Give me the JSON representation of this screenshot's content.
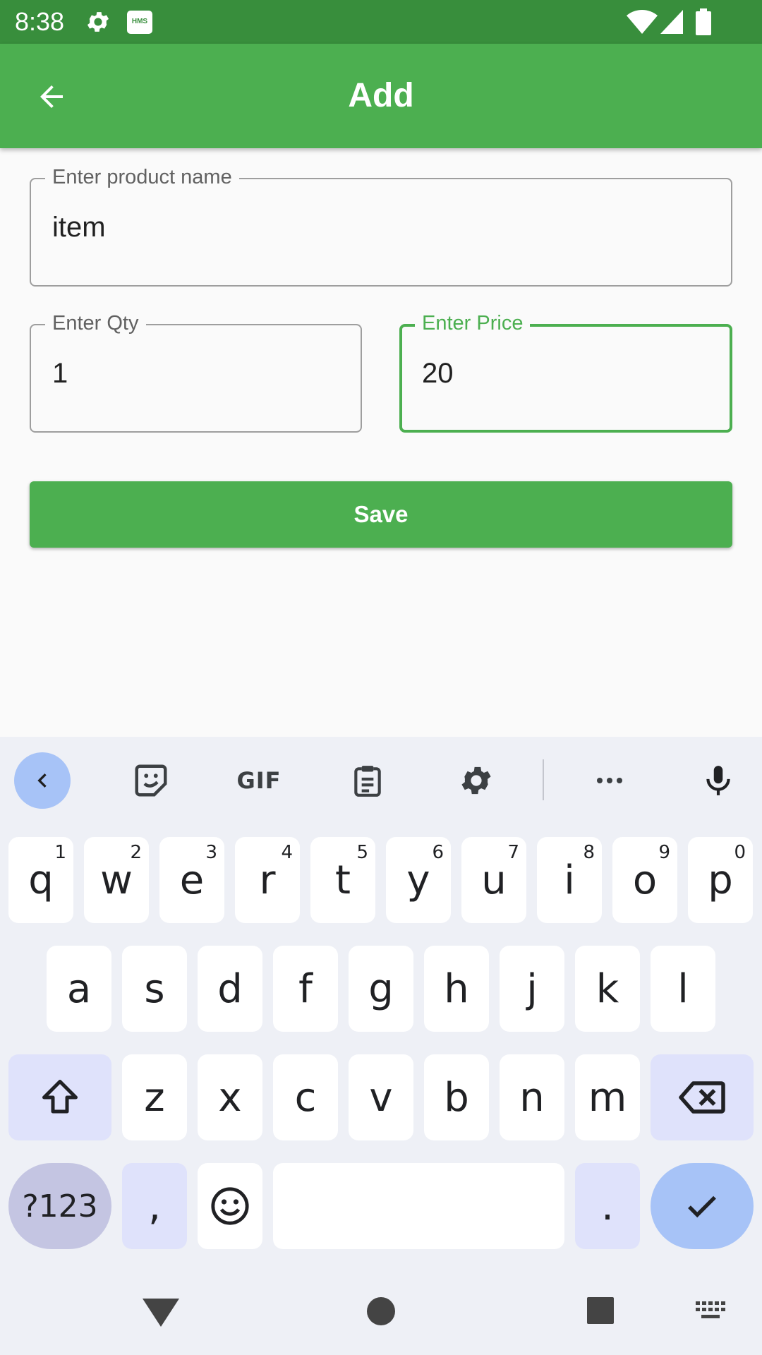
{
  "status_bar": {
    "time": "8:38"
  },
  "app_bar": {
    "title": "Add"
  },
  "form": {
    "product_name": {
      "label": "Enter product name",
      "value": "item"
    },
    "qty": {
      "label": "Enter Qty",
      "value": "1"
    },
    "price": {
      "label": "Enter Price",
      "value": "20"
    },
    "save_label": "Save"
  },
  "keyboard": {
    "toolbar": {
      "gif_label": "GIF"
    },
    "row1": [
      {
        "k": "q",
        "h": "1"
      },
      {
        "k": "w",
        "h": "2"
      },
      {
        "k": "e",
        "h": "3"
      },
      {
        "k": "r",
        "h": "4"
      },
      {
        "k": "t",
        "h": "5"
      },
      {
        "k": "y",
        "h": "6"
      },
      {
        "k": "u",
        "h": "7"
      },
      {
        "k": "i",
        "h": "8"
      },
      {
        "k": "o",
        "h": "9"
      },
      {
        "k": "p",
        "h": "0"
      }
    ],
    "row2": [
      "a",
      "s",
      "d",
      "f",
      "g",
      "h",
      "j",
      "k",
      "l"
    ],
    "row3": [
      "z",
      "x",
      "c",
      "v",
      "b",
      "n",
      "m"
    ],
    "row4": {
      "symbols": "?123",
      "comma": ",",
      "period": "."
    }
  },
  "colors": {
    "primary": "#4caf50",
    "primary_dark": "#388e3c",
    "key_accent": "#a7c3f7",
    "mod_key": "#dfe2fb"
  }
}
